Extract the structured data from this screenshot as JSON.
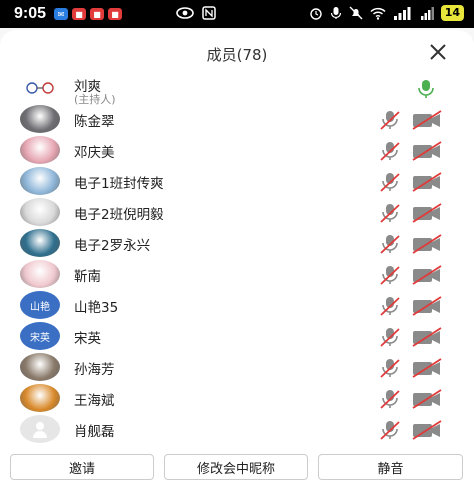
{
  "status_bar": {
    "time": "9:05",
    "battery": "14"
  },
  "header": {
    "title": "成员(78)",
    "close_icon": "close-icon"
  },
  "members": [
    {
      "name": "刘爽",
      "sub": "(主持人)",
      "avatar_kind": "host",
      "mic_state": "on",
      "cam_state": "none"
    },
    {
      "name": "陈金翠",
      "avatar_kind": "photo",
      "avatar_color": "#6e6e73",
      "mic_state": "muted",
      "cam_state": "off"
    },
    {
      "name": "邓庆美",
      "avatar_kind": "photo",
      "avatar_color": "#e7a7b3",
      "mic_state": "muted",
      "cam_state": "off"
    },
    {
      "name": "电子1班封传爽",
      "avatar_kind": "photo",
      "avatar_color": "#8fb7d9",
      "mic_state": "muted",
      "cam_state": "off"
    },
    {
      "name": "电子2班倪明毅",
      "avatar_kind": "photo",
      "avatar_color": "#d9d9d9",
      "mic_state": "muted",
      "cam_state": "off"
    },
    {
      "name": "电子2罗永兴",
      "avatar_kind": "photo",
      "avatar_color": "#2f6f8e",
      "mic_state": "muted",
      "cam_state": "off"
    },
    {
      "name": "靳南",
      "avatar_kind": "photo",
      "avatar_color": "#f0c9cf",
      "mic_state": "muted",
      "cam_state": "off"
    },
    {
      "name": "山艳35",
      "avatar_kind": "text",
      "avatar_text": "山艳",
      "avatar_color": "#3a6fc4",
      "mic_state": "muted",
      "cam_state": "off"
    },
    {
      "name": "宋英",
      "avatar_kind": "text",
      "avatar_text": "宋英",
      "avatar_color": "#3a6fc4",
      "mic_state": "muted",
      "cam_state": "off"
    },
    {
      "name": "孙海芳",
      "avatar_kind": "photo",
      "avatar_color": "#8a7a6a",
      "mic_state": "muted",
      "cam_state": "off"
    },
    {
      "name": "王海斌",
      "avatar_kind": "photo",
      "avatar_color": "#d98a2b",
      "mic_state": "muted",
      "cam_state": "off"
    },
    {
      "name": "肖舰磊",
      "avatar_kind": "default",
      "avatar_color": "#e6e6e6",
      "mic_state": "muted",
      "cam_state": "off"
    }
  ],
  "actions": {
    "invite": "邀请",
    "rename": "修改会中昵称",
    "mute": "静音"
  },
  "colors": {
    "muted_red": "#e03a3a",
    "icon_gray": "#8a8a8a",
    "mic_on_green": "#4caf50"
  }
}
